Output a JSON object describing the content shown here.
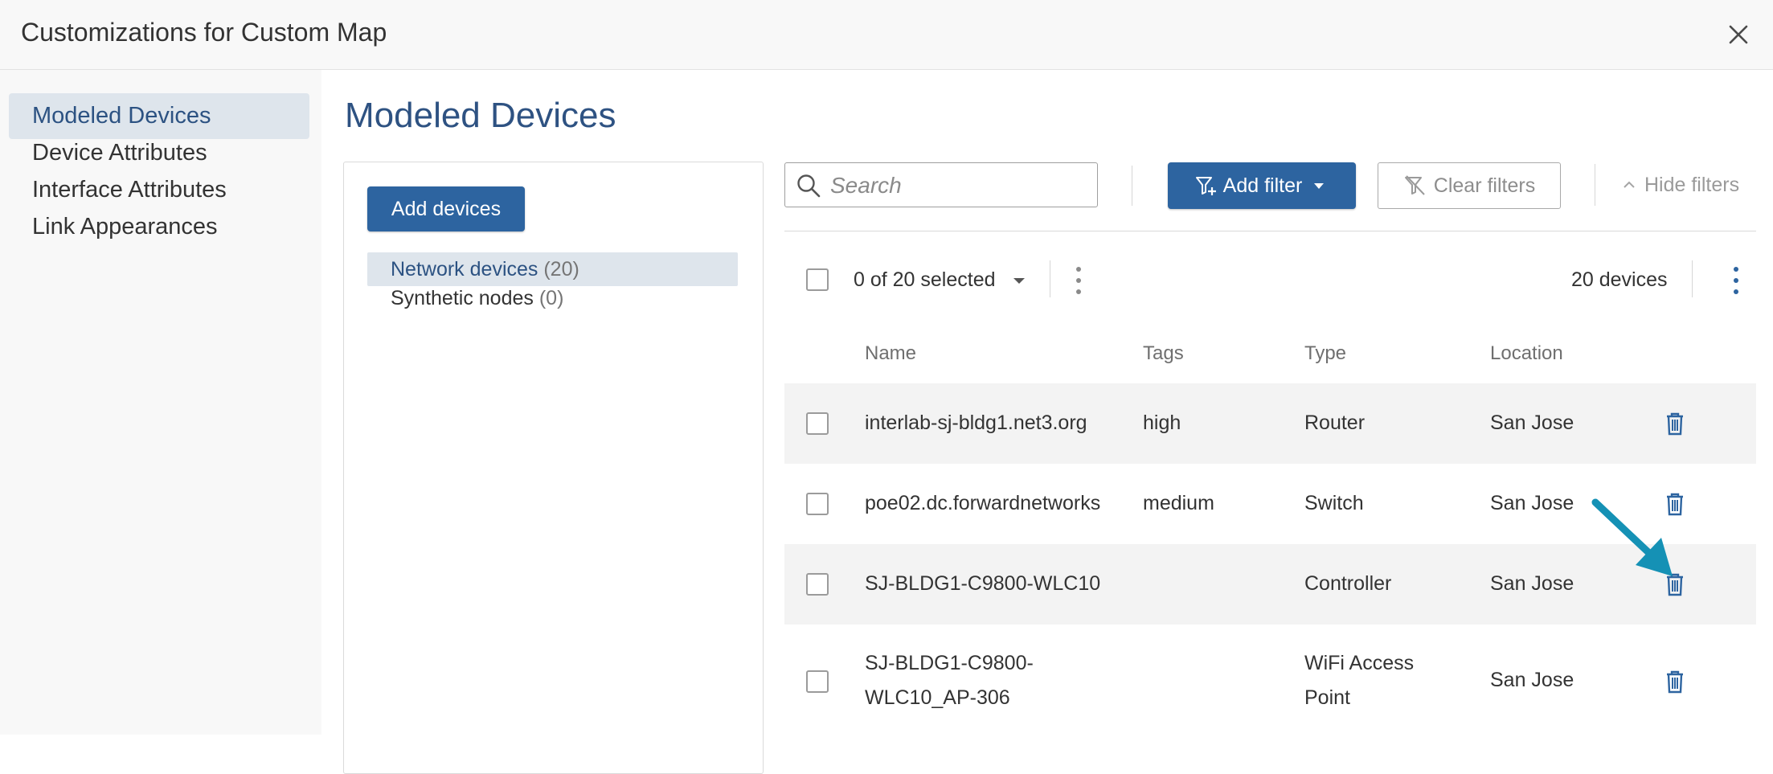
{
  "dialog": {
    "title": "Customizations for Custom Map"
  },
  "nav": {
    "items": [
      {
        "label": "Modeled Devices",
        "active": true
      },
      {
        "label": "Device Attributes",
        "active": false
      },
      {
        "label": "Interface Attributes",
        "active": false
      },
      {
        "label": "Link Appearances",
        "active": false
      }
    ]
  },
  "main": {
    "title": "Modeled Devices",
    "add_devices_label": "Add devices",
    "device_groups": [
      {
        "label": "Network devices",
        "count": "(20)",
        "active": true
      },
      {
        "label": "Synthetic nodes",
        "count": "(0)",
        "active": false
      }
    ],
    "toolbar": {
      "search_placeholder": "Search",
      "add_filter_label": "Add filter",
      "clear_filters_label": "Clear filters",
      "hide_filters_label": "Hide filters"
    },
    "selection": {
      "text": "0 of 20 selected",
      "device_count": "20 devices"
    },
    "table": {
      "headers": [
        "Name",
        "Tags",
        "Type",
        "Location"
      ],
      "rows": [
        {
          "name": [
            "interlab-sj-bldg1.net3.org"
          ],
          "tags": "high",
          "type": [
            "Router"
          ],
          "location": "San Jose"
        },
        {
          "name": [
            "poe02.dc.forwardnetworks"
          ],
          "tags": "medium",
          "type": [
            "Switch"
          ],
          "location": "San Jose"
        },
        {
          "name": [
            "SJ-BLDG1-C9800-WLC10"
          ],
          "tags": "",
          "type": [
            "Controller"
          ],
          "location": "San Jose"
        },
        {
          "name": [
            "SJ-BLDG1-C9800-",
            "WLC10_AP-306"
          ],
          "tags": "",
          "type": [
            "WiFi Access",
            "Point"
          ],
          "location": "San Jose"
        }
      ]
    }
  },
  "colors": {
    "primary": "#2d64a0",
    "title_blue": "#2e5282",
    "nav_active_bg": "#dee5ec",
    "trash_icon": "#2d64a0",
    "annotation_arrow": "#1591b5"
  },
  "icons": {
    "close": "close-icon",
    "search": "search-icon",
    "filter": "filter-icon",
    "clear_filter": "clear-filter-icon",
    "delete": "trash-icon",
    "more": "more-vertical-icon",
    "caret": "caret-down-icon",
    "chevron_up": "chevron-up-icon",
    "annotation": "arrow-icon"
  }
}
